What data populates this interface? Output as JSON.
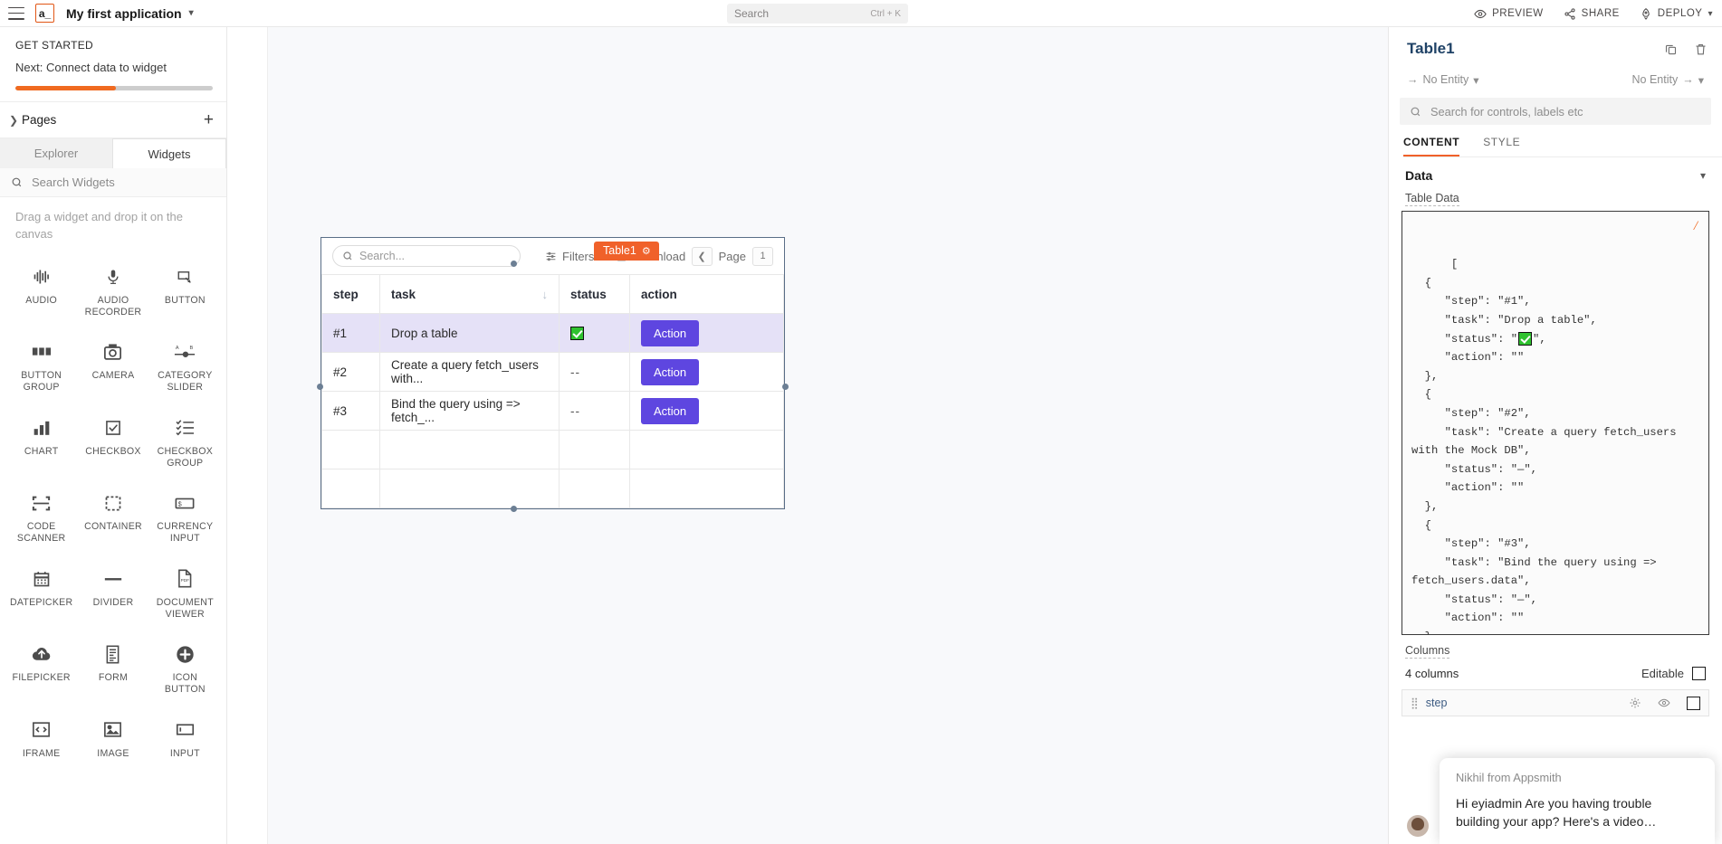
{
  "topbar": {
    "logo_text": "a_",
    "app_name": "My first application",
    "search_placeholder": "Search",
    "search_shortcut": "Ctrl + K",
    "actions": [
      {
        "label": "PREVIEW",
        "icon": "eye-icon"
      },
      {
        "label": "SHARE",
        "icon": "share-icon"
      },
      {
        "label": "DEPLOY",
        "icon": "rocket-icon"
      }
    ]
  },
  "sidebar": {
    "get_started_title": "GET STARTED",
    "next_step": "Next: Connect data to widget",
    "progress_percent": 51,
    "pages_label": "Pages",
    "add_page_icon": "plus-icon",
    "tabs": [
      {
        "label": "Explorer",
        "active": false
      },
      {
        "label": "Widgets",
        "active": true
      }
    ],
    "search_placeholder": "Search Widgets",
    "hint": "Drag a widget and drop it on the canvas",
    "widgets": [
      {
        "label": "AUDIO",
        "icon": "audio-waveform-icon"
      },
      {
        "label": "AUDIO RECORDER",
        "icon": "microphone-icon"
      },
      {
        "label": "BUTTON",
        "icon": "button-icon"
      },
      {
        "label": "BUTTON GROUP",
        "icon": "button-group-icon"
      },
      {
        "label": "CAMERA",
        "icon": "camera-icon"
      },
      {
        "label": "CATEGORY SLIDER",
        "icon": "category-slider-icon"
      },
      {
        "label": "CHART",
        "icon": "bar-chart-icon"
      },
      {
        "label": "CHECKBOX",
        "icon": "checkbox-icon"
      },
      {
        "label": "CHECKBOX GROUP",
        "icon": "checkbox-group-icon"
      },
      {
        "label": "CODE SCANNER",
        "icon": "code-scanner-icon"
      },
      {
        "label": "CONTAINER",
        "icon": "container-icon"
      },
      {
        "label": "CURRENCY INPUT",
        "icon": "currency-input-icon"
      },
      {
        "label": "DATEPICKER",
        "icon": "calendar-icon"
      },
      {
        "label": "DIVIDER",
        "icon": "divider-icon"
      },
      {
        "label": "DOCUMENT VIEWER",
        "icon": "pdf-document-icon"
      },
      {
        "label": "FILEPICKER",
        "icon": "cloud-upload-icon"
      },
      {
        "label": "FORM",
        "icon": "form-icon"
      },
      {
        "label": "ICON BUTTON",
        "icon": "plus-circle-icon"
      },
      {
        "label": "IFRAME",
        "icon": "iframe-icon"
      },
      {
        "label": "IMAGE",
        "icon": "image-icon"
      },
      {
        "label": "INPUT",
        "icon": "input-icon"
      }
    ]
  },
  "canvas": {
    "widget_tag": "Table1",
    "widget_tag_icon": "gear-icon",
    "table": {
      "search_placeholder": "Search...",
      "filters_label": "Filters",
      "download_label": "Download",
      "page_label": "Page",
      "page_number": "1",
      "prev_icon": "chevron-left-icon",
      "columns": [
        {
          "key": "step",
          "label": "step",
          "sorted": false
        },
        {
          "key": "task",
          "label": "task",
          "sorted": true
        },
        {
          "key": "status",
          "label": "status",
          "sorted": false
        },
        {
          "key": "action",
          "label": "action",
          "sorted": false
        }
      ],
      "rows": [
        {
          "step": "#1",
          "task": "Drop a table",
          "status": "check",
          "action": "Action",
          "selected": true
        },
        {
          "step": "#2",
          "task": "Create a query fetch_users with...",
          "status": "--",
          "action": "Action",
          "selected": false
        },
        {
          "step": "#3",
          "task": "Bind the query using => fetch_...",
          "status": "--",
          "action": "Action",
          "selected": false
        }
      ],
      "empty_rows": 2
    }
  },
  "properties": {
    "title": "Table1",
    "copy_icon": "copy-icon",
    "delete_icon": "trash-icon",
    "entity_in": "No Entity",
    "entity_out": "No Entity",
    "search_placeholder": "Search for controls, labels etc",
    "tabs": [
      {
        "label": "CONTENT",
        "active": true
      },
      {
        "label": "STYLE",
        "active": false
      }
    ],
    "section_data": "Data",
    "table_data_label": "Table Data",
    "table_data_code_1": "[\n  {\n     \"step\": \"#1\",\n     \"task\": \"Drop a table\",\n     \"status\": \"",
    "table_data_code_2": "\",\n     \"action\": \"\"\n  },\n  {\n     \"step\": \"#2\",\n     \"task\": \"Create a query fetch_users with the Mock DB\",\n     \"status\": \"—\",\n     \"action\": \"\"\n  },\n  {\n     \"step\": \"#3\",\n     \"task\": \"Bind the query using => fetch_users.data\",\n     \"status\": \"—\",\n     \"action\": \"\"\n  }\n]",
    "columns_label": "Columns",
    "columns_count": "4 columns",
    "editable_label": "Editable",
    "column_items": [
      {
        "name": "step",
        "settings_icon": "gear-icon",
        "visibility_icon": "eye-icon"
      }
    ]
  },
  "chat": {
    "from": "Nikhil from Appsmith",
    "message": "Hi eyiadmin Are you having trouble building your app? Here's a video…"
  },
  "colors": {
    "accent": "#f0612a",
    "action_button": "#5e46e0",
    "selected_row": "#e5e1f7",
    "status_check": "#2fc22f",
    "widget_border": "#5a6e87"
  }
}
